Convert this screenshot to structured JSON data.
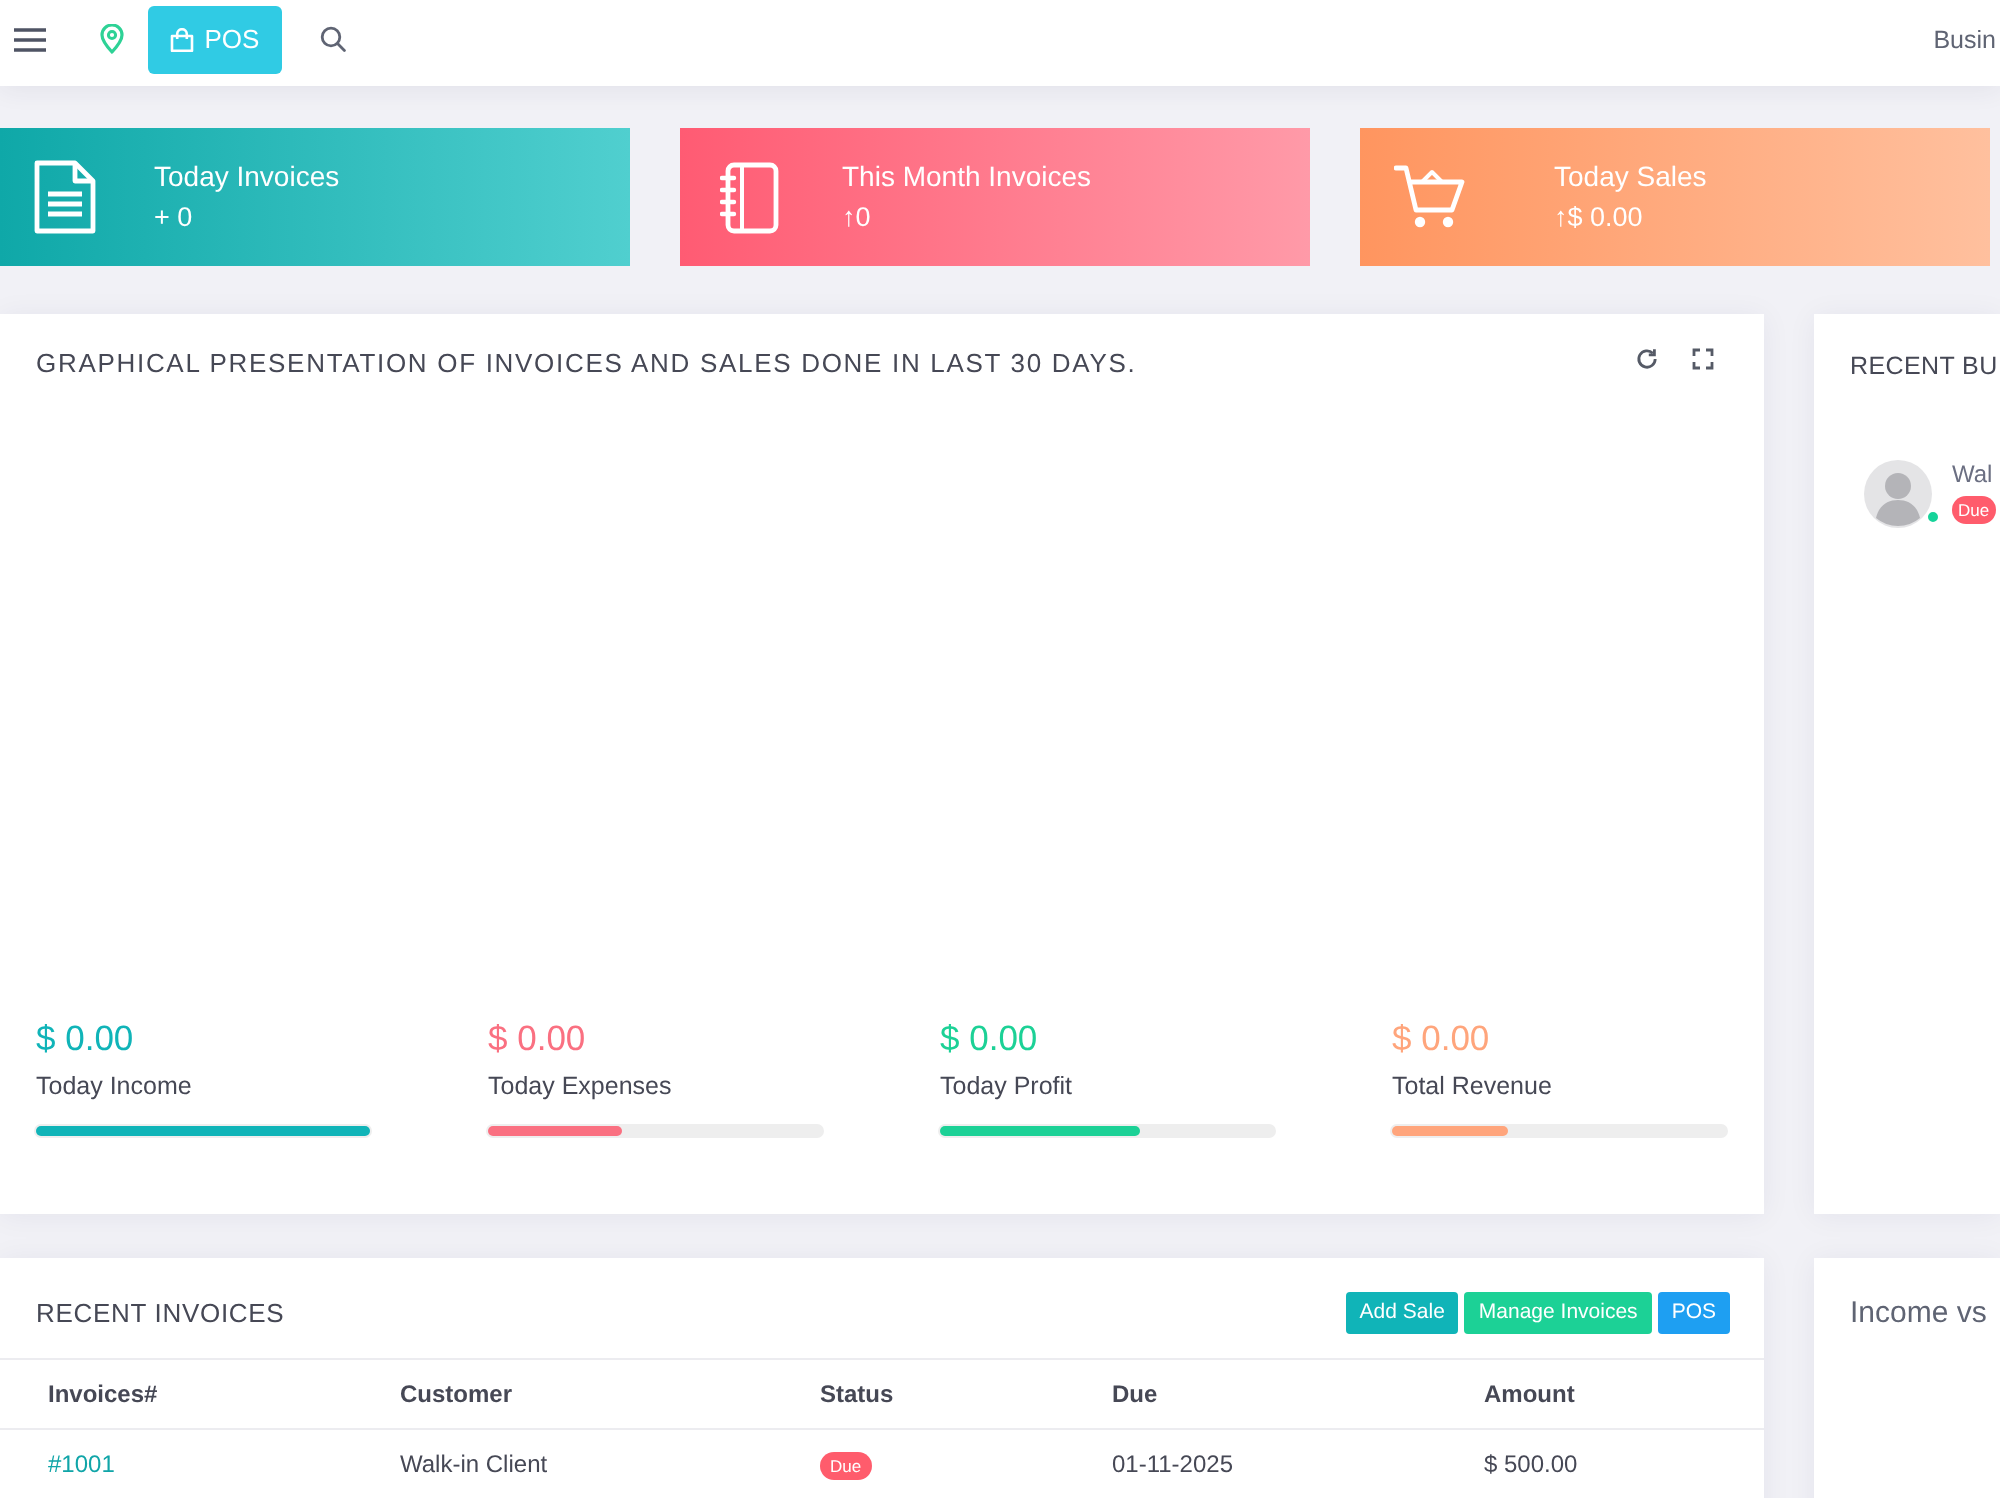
{
  "header": {
    "pos_button": "POS",
    "business_name": "Busin"
  },
  "stat_cards": [
    {
      "kind": "document",
      "title": "Today Invoices",
      "value": "+ 0"
    },
    {
      "kind": "notebook",
      "title": "This Month Invoices",
      "value": "↑0"
    },
    {
      "kind": "cart",
      "title": "Today Sales",
      "value": "↑$ 0.00"
    }
  ],
  "chart_panel": {
    "title": "GRAPHICAL PRESENTATION OF INVOICES AND SALES DONE IN LAST 30 DAYS.",
    "metrics": [
      {
        "value": "$ 0.00",
        "label": "Today Income",
        "level": 1,
        "color": "#10b4b8"
      },
      {
        "value": "$ 0.00",
        "label": "Today Expenses",
        "level": 0.4,
        "color": "#fa7081"
      },
      {
        "value": "$ 0.00",
        "label": "Today Profit",
        "level": 0.6,
        "color": "#1cd196"
      },
      {
        "value": "$ 0.00",
        "label": "Total Revenue",
        "level": 0.35,
        "color": "#ffa57c"
      }
    ]
  },
  "recent_business": {
    "title": "RECENT BU",
    "items": [
      {
        "name": "Wal",
        "online": true,
        "badge": {
          "label": "Due",
          "color": "#ff5c6c"
        }
      }
    ]
  },
  "recent_invoices": {
    "title": "RECENT INVOICES",
    "buttons": [
      {
        "label": "Add Sale",
        "color": "#10b4b8"
      },
      {
        "label": "Manage Invoices",
        "color": "#1cd196"
      },
      {
        "label": "POS",
        "color": "#1e9ff2"
      }
    ],
    "columns": [
      "Invoices#",
      "Customer",
      "Status",
      "Due",
      "Amount"
    ],
    "rows": [
      {
        "invoice": "#1001",
        "customer": "Walk-in Client",
        "status": {
          "label": "Due",
          "color": "#ff5c6c"
        },
        "due": "01-11-2025",
        "amount": "$ 500.00"
      }
    ]
  },
  "income_panel": {
    "title": "Income vs"
  }
}
